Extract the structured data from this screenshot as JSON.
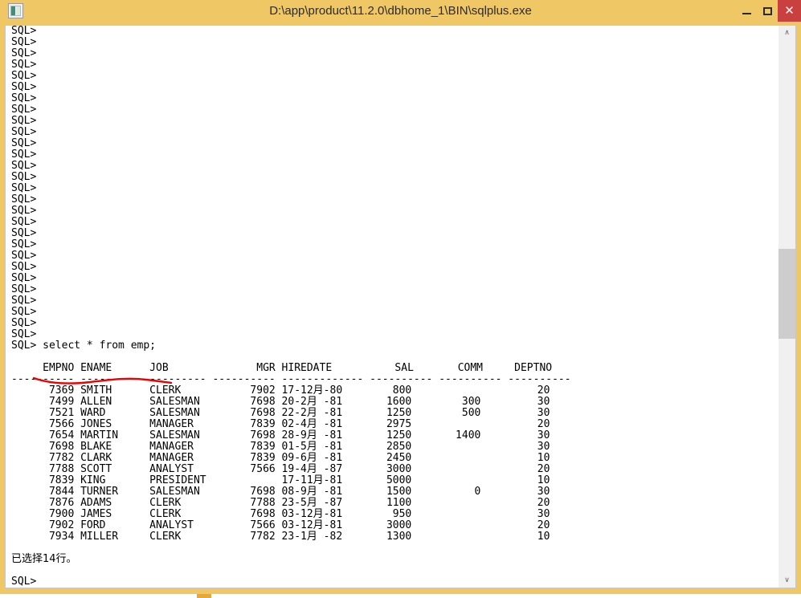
{
  "window": {
    "title": "D:\\app\\product\\11.2.0\\dbhome_1\\BIN\\sqlplus.exe",
    "icon_name": "sqlplus-app-icon",
    "controls": {
      "minimize_label": "–",
      "maximize_label": "☐",
      "close_label": "✕"
    },
    "colors": {
      "frame": "#f0c765",
      "console_bg": "#ffffff",
      "console_text": "#000000",
      "close_button": "#c9413f",
      "annotation": "#ee0000",
      "scroll_thumb": "#cdcdcd"
    }
  },
  "console": {
    "prompt": "SQL>",
    "blank_prompt_count": 28,
    "command_line": "SQL> select * from emp;",
    "command": "select * from emp;",
    "annotation": {
      "type": "hand-drawn-underline",
      "color": "#ee0000",
      "target_text": "select * from emp;"
    },
    "blank_line": "",
    "result_header": "     EMPNO ENAME      JOB              MGR HIREDATE          SAL       COMM     DEPTNO",
    "result_separator": "---------- ---------- --------- ---------- ------------- ---------- ---------- ----------",
    "rows_text": [
      "      7369 SMITH      CLERK           7902 17-12月-80        800                    20",
      "      7499 ALLEN      SALESMAN        7698 20-2月 -81       1600        300         30",
      "      7521 WARD       SALESMAN        7698 22-2月 -81       1250        500         30",
      "      7566 JONES      MANAGER         7839 02-4月 -81       2975                    20",
      "      7654 MARTIN     SALESMAN        7698 28-9月 -81       1250       1400         30",
      "      7698 BLAKE      MANAGER         7839 01-5月 -81       2850                    30",
      "      7782 CLARK      MANAGER         7839 09-6月 -81       2450                    10",
      "      7788 SCOTT      ANALYST         7566 19-4月 -87       3000                    20",
      "      7839 KING       PRESIDENT            17-11月-81       5000                    10",
      "      7844 TURNER     SALESMAN        7698 08-9月 -81       1500          0         30",
      "      7876 ADAMS      CLERK           7788 23-5月 -87       1100                    20",
      "      7900 JAMES      CLERK           7698 03-12月-81        950                    30",
      "      7902 FORD       ANALYST         7566 03-12月-81       3000                    20",
      "      7934 MILLER     CLERK           7782 23-1月 -82       1300                    10"
    ],
    "footer": "已选择14行。",
    "final_prompt": "SQL>"
  },
  "table": {
    "columns": [
      "EMPNO",
      "ENAME",
      "JOB",
      "MGR",
      "HIREDATE",
      "SAL",
      "COMM",
      "DEPTNO"
    ],
    "rows": [
      {
        "EMPNO": "7369",
        "ENAME": "SMITH",
        "JOB": "CLERK",
        "MGR": "7902",
        "HIREDATE": "17-12月-80",
        "SAL": "800",
        "COMM": "",
        "DEPTNO": "20"
      },
      {
        "EMPNO": "7499",
        "ENAME": "ALLEN",
        "JOB": "SALESMAN",
        "MGR": "7698",
        "HIREDATE": "20-2月 -81",
        "SAL": "1600",
        "COMM": "300",
        "DEPTNO": "30"
      },
      {
        "EMPNO": "7521",
        "ENAME": "WARD",
        "JOB": "SALESMAN",
        "MGR": "7698",
        "HIREDATE": "22-2月 -81",
        "SAL": "1250",
        "COMM": "500",
        "DEPTNO": "30"
      },
      {
        "EMPNO": "7566",
        "ENAME": "JONES",
        "JOB": "MANAGER",
        "MGR": "7839",
        "HIREDATE": "02-4月 -81",
        "SAL": "2975",
        "COMM": "",
        "DEPTNO": "20"
      },
      {
        "EMPNO": "7654",
        "ENAME": "MARTIN",
        "JOB": "SALESMAN",
        "MGR": "7698",
        "HIREDATE": "28-9月 -81",
        "SAL": "1250",
        "COMM": "1400",
        "DEPTNO": "30"
      },
      {
        "EMPNO": "7698",
        "ENAME": "BLAKE",
        "JOB": "MANAGER",
        "MGR": "7839",
        "HIREDATE": "01-5月 -81",
        "SAL": "2850",
        "COMM": "",
        "DEPTNO": "30"
      },
      {
        "EMPNO": "7782",
        "ENAME": "CLARK",
        "JOB": "MANAGER",
        "MGR": "7839",
        "HIREDATE": "09-6月 -81",
        "SAL": "2450",
        "COMM": "",
        "DEPTNO": "10"
      },
      {
        "EMPNO": "7788",
        "ENAME": "SCOTT",
        "JOB": "ANALYST",
        "MGR": "7566",
        "HIREDATE": "19-4月 -87",
        "SAL": "3000",
        "COMM": "",
        "DEPTNO": "20"
      },
      {
        "EMPNO": "7839",
        "ENAME": "KING",
        "JOB": "PRESIDENT",
        "MGR": "",
        "HIREDATE": "17-11月-81",
        "SAL": "5000",
        "COMM": "",
        "DEPTNO": "10"
      },
      {
        "EMPNO": "7844",
        "ENAME": "TURNER",
        "JOB": "SALESMAN",
        "MGR": "7698",
        "HIREDATE": "08-9月 -81",
        "SAL": "1500",
        "COMM": "0",
        "DEPTNO": "30"
      },
      {
        "EMPNO": "7876",
        "ENAME": "ADAMS",
        "JOB": "CLERK",
        "MGR": "7788",
        "HIREDATE": "23-5月 -87",
        "SAL": "1100",
        "COMM": "",
        "DEPTNO": "20"
      },
      {
        "EMPNO": "7900",
        "ENAME": "JAMES",
        "JOB": "CLERK",
        "MGR": "7698",
        "HIREDATE": "03-12月-81",
        "SAL": "950",
        "COMM": "",
        "DEPTNO": "30"
      },
      {
        "EMPNO": "7902",
        "ENAME": "FORD",
        "JOB": "ANALYST",
        "MGR": "7566",
        "HIREDATE": "03-12月-81",
        "SAL": "3000",
        "COMM": "",
        "DEPTNO": "20"
      },
      {
        "EMPNO": "7934",
        "ENAME": "MILLER",
        "JOB": "CLERK",
        "MGR": "7782",
        "HIREDATE": "23-1月 -82",
        "SAL": "1300",
        "COMM": "",
        "DEPTNO": "10"
      }
    ],
    "row_count": 14
  },
  "scrollbar": {
    "up_arrow": "∧",
    "down_arrow": "∨"
  }
}
